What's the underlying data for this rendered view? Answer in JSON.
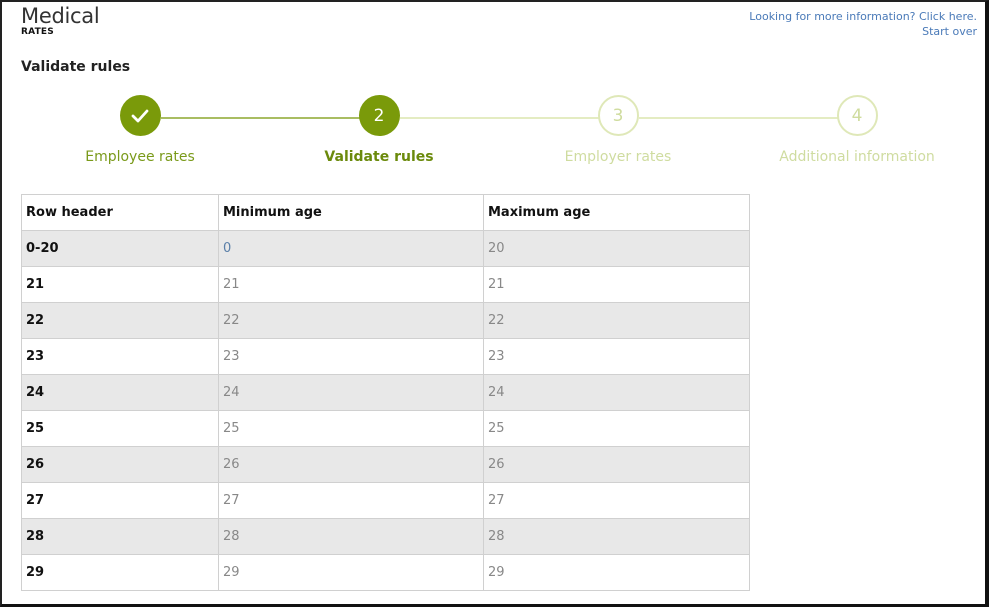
{
  "header": {
    "title": "Medical",
    "subtitle": "RATES",
    "more_info_link": "Looking for more information? Click here.",
    "start_over_link": "Start over"
  },
  "section_title": "Validate rules",
  "steps": [
    {
      "number": "",
      "label": "Employee rates",
      "state": "done"
    },
    {
      "number": "2",
      "label": "Validate rules",
      "state": "active"
    },
    {
      "number": "3",
      "label": "Employer rates",
      "state": "todo"
    },
    {
      "number": "4",
      "label": "Additional information",
      "state": "todo"
    }
  ],
  "colors": {
    "accent": "#7a9a0a",
    "inactive_step": "#dfe8b8",
    "link": "#4a7ab8",
    "row_shade": "#e8e8e8"
  },
  "table": {
    "columns": [
      "Row header",
      "Minimum age",
      "Maximum age"
    ],
    "rows": [
      [
        "0-20",
        "0",
        "20"
      ],
      [
        "21",
        "21",
        "21"
      ],
      [
        "22",
        "22",
        "22"
      ],
      [
        "23",
        "23",
        "23"
      ],
      [
        "24",
        "24",
        "24"
      ],
      [
        "25",
        "25",
        "25"
      ],
      [
        "26",
        "26",
        "26"
      ],
      [
        "27",
        "27",
        "27"
      ],
      [
        "28",
        "28",
        "28"
      ],
      [
        "29",
        "29",
        "29"
      ]
    ]
  }
}
